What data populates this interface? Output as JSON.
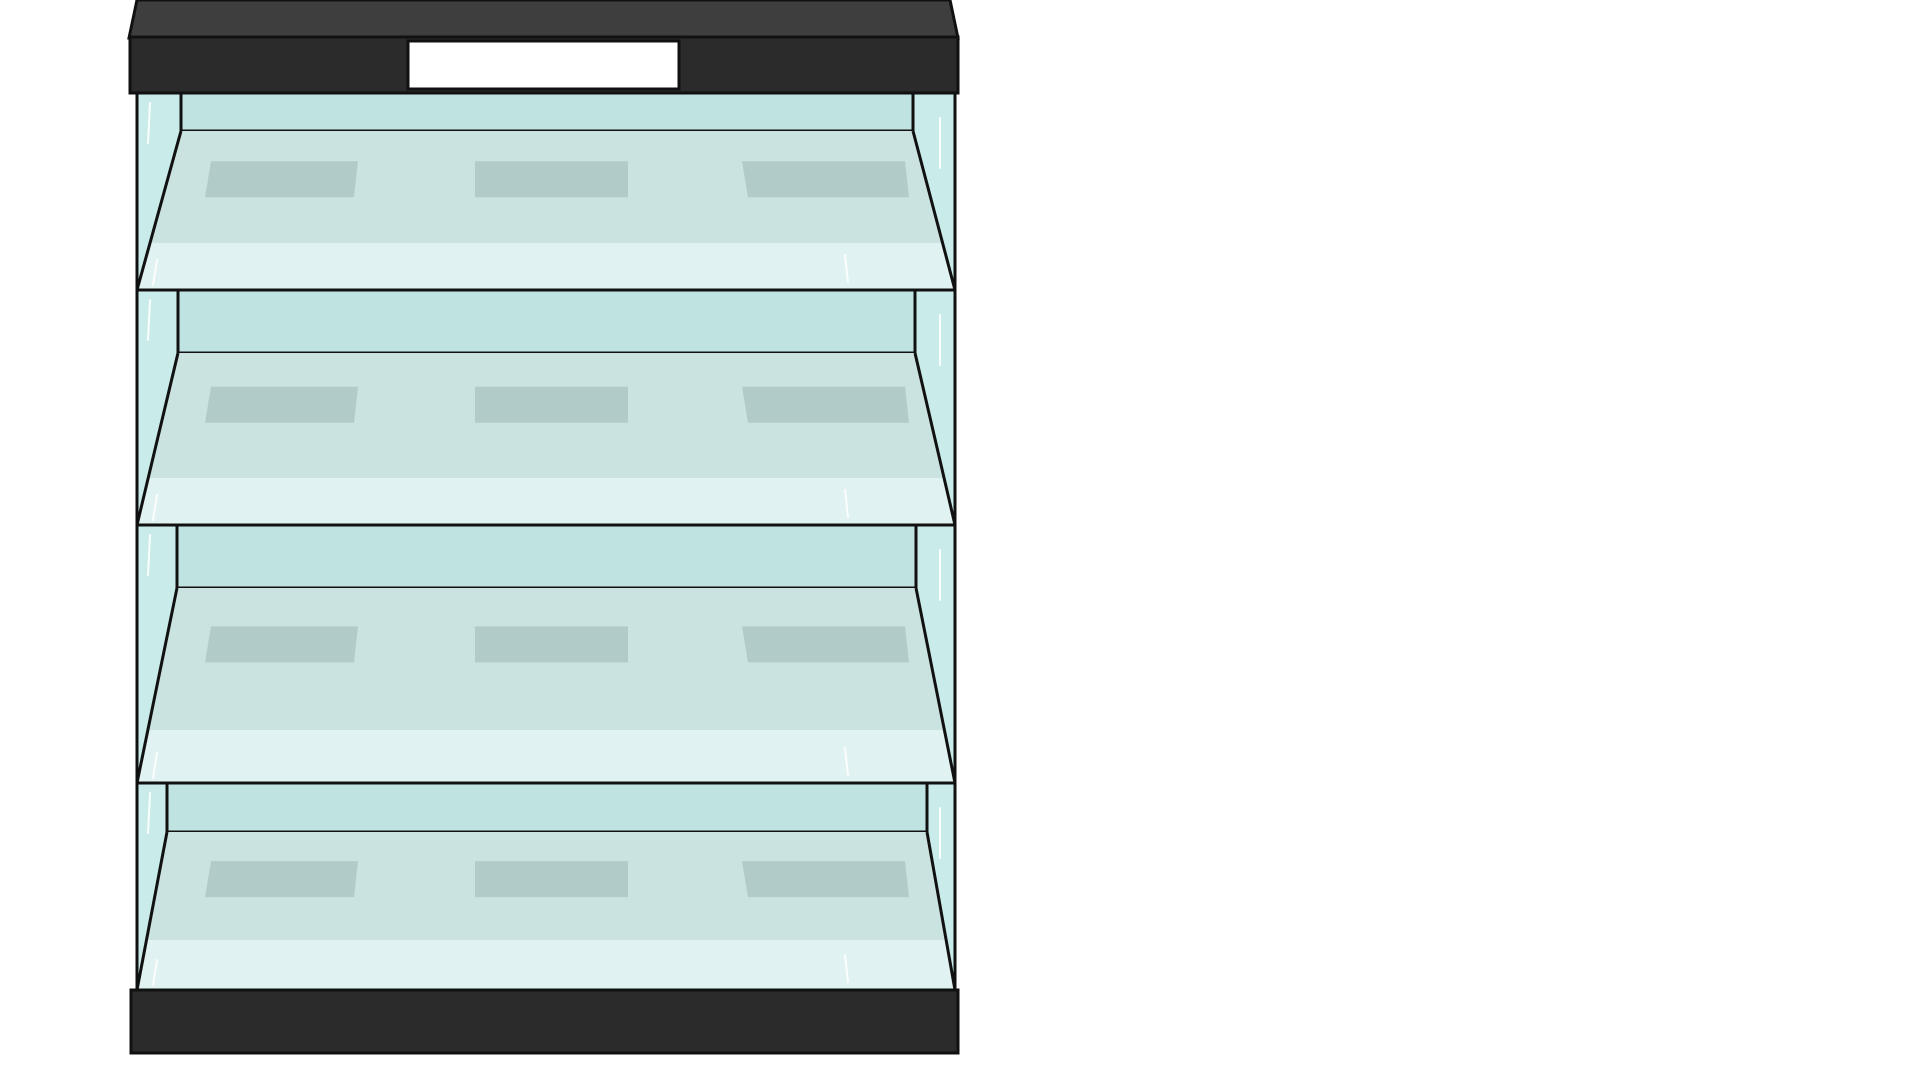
{
  "display_case": {
    "shelf_count": 4,
    "slots_per_shelf": 3,
    "sign_text": "",
    "colors": {
      "frame": "#2a2b2a",
      "frame_top": "#3e3e3e",
      "sign": "#ffffff",
      "glass_side": "#c9ebe9",
      "back_panel": "#bfe3e1",
      "shelf_surface": "#cbe3e0",
      "shelf_front": "#e0f2f1",
      "slot": "#b1cbc8",
      "outline": "#111111",
      "highlight": "#ffffff"
    }
  }
}
